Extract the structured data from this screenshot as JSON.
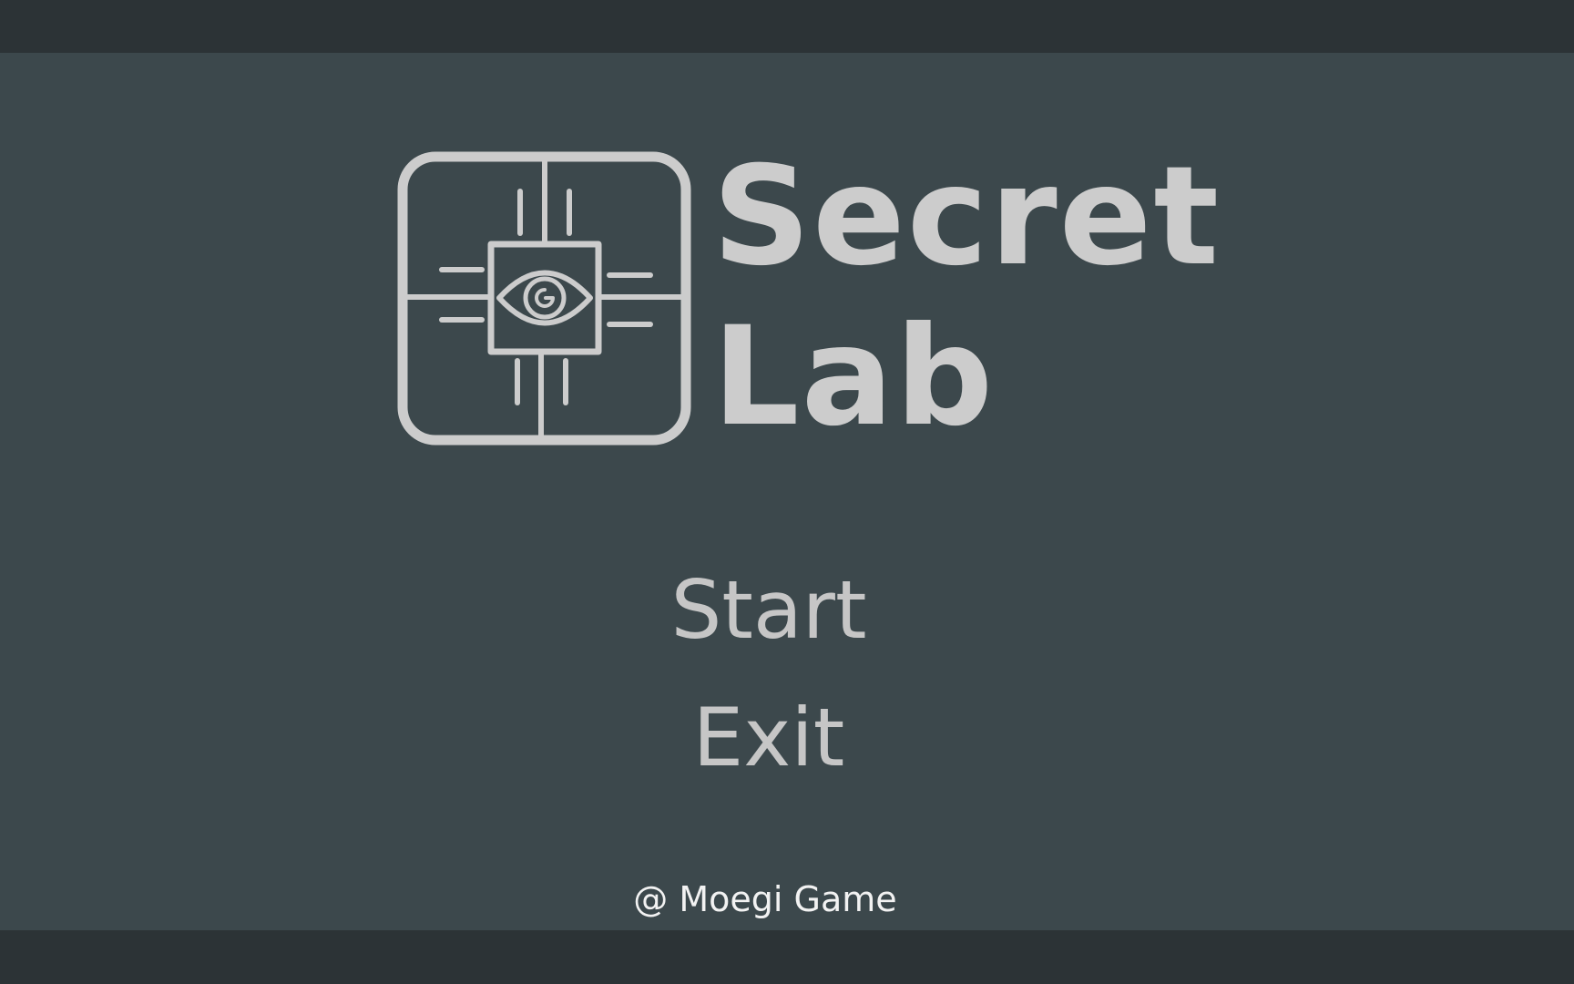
{
  "title": {
    "line1": "Secret",
    "line2": "Lab"
  },
  "logo": {
    "icon": "eye-chip-icon",
    "color": "#cccccc"
  },
  "menu": {
    "items": [
      {
        "label": "Start"
      },
      {
        "label": "Exit"
      }
    ]
  },
  "credit": "@ Moegi Game",
  "colors": {
    "background": "#3c484c",
    "letterbox": "#2c3336",
    "text": "#cccccc",
    "credit_text": "#f2f2f2"
  }
}
